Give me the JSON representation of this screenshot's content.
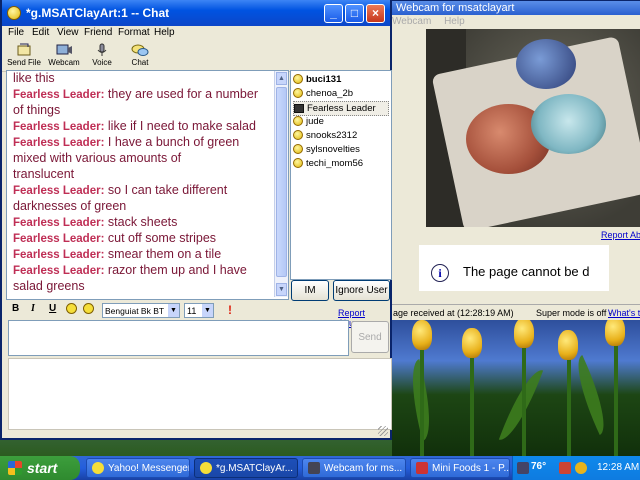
{
  "chat_window": {
    "title": "*g.MSATClayArt:1 -- Chat",
    "menu": [
      "File",
      "Edit",
      "View",
      "Friend",
      "Format",
      "Help"
    ],
    "toolbar": [
      {
        "label": "Send File",
        "icon": "send-file-icon"
      },
      {
        "label": "Webcam",
        "icon": "webcam-icon"
      },
      {
        "label": "Voice",
        "icon": "microphone-icon"
      },
      {
        "label": "Chat",
        "icon": "chat-bubbles-icon"
      }
    ],
    "messages": [
      {
        "nick": "",
        "text": "like this"
      },
      {
        "nick": "Fearless Leader:",
        "text": "they are used for a number"
      },
      {
        "nick": "",
        "text": "of things"
      },
      {
        "nick": "Fearless Leader:",
        "text": "like if I need to make salad"
      },
      {
        "nick": "Fearless Leader:",
        "text": "I have a bunch of green"
      },
      {
        "nick": "",
        "text": "mixed with various amounts of"
      },
      {
        "nick": "",
        "text": "translucent"
      },
      {
        "nick": "Fearless Leader:",
        "text": "so I can take different"
      },
      {
        "nick": "",
        "text": "darknesses of green"
      },
      {
        "nick": "Fearless Leader:",
        "text": "stack sheets"
      },
      {
        "nick": "Fearless Leader:",
        "text": "cut off some stripes"
      },
      {
        "nick": "Fearless Leader:",
        "text": "smear them on a tile"
      },
      {
        "nick": "Fearless Leader:",
        "text": "razor them up and I have"
      },
      {
        "nick": "",
        "text": "salad greens"
      }
    ],
    "users": [
      {
        "name": "buci131",
        "bold": true,
        "icon": "smiley-icon"
      },
      {
        "name": "chenoa_2b",
        "bold": false,
        "icon": "smiley-icon"
      },
      {
        "name": "Fearless Leader",
        "bold": false,
        "icon": "webcam-icon",
        "selected": true
      },
      {
        "name": "jude",
        "bold": false,
        "icon": "smiley-icon"
      },
      {
        "name": "snooks2312",
        "bold": false,
        "icon": "smiley-icon"
      },
      {
        "name": "sylsnovelties",
        "bold": false,
        "icon": "smiley-icon"
      },
      {
        "name": "techi_mom56",
        "bold": false,
        "icon": "smiley-icon"
      }
    ],
    "im_button": "IM",
    "ignore_button": "Ignore User",
    "format": {
      "bold": "B",
      "italic": "I",
      "underline": "U",
      "font": "Benguiat Bk BT",
      "size": "11"
    },
    "report_abuse": "Report Abuse",
    "send_button": "Send"
  },
  "webcam_window": {
    "title": "Webcam for msatclayart",
    "menu": [
      "Webcam",
      "Help"
    ],
    "report_link": "Report Ab",
    "cannot_text": "The page cannot be d",
    "status_received": "age received at (12:28:19 AM)",
    "status_super": "Super mode is off -",
    "status_link": "What's t"
  },
  "taskbar": {
    "start": "start",
    "tasks": [
      {
        "label": "Yahoo! Messenger",
        "active": false
      },
      {
        "label": "*g.MSATClayAr...",
        "active": true
      },
      {
        "label": "Webcam for ms...",
        "active": false
      },
      {
        "label": "Mini Foods 1 - P...",
        "active": false
      }
    ],
    "temperature": "76°",
    "clock": "12:28 AM"
  }
}
